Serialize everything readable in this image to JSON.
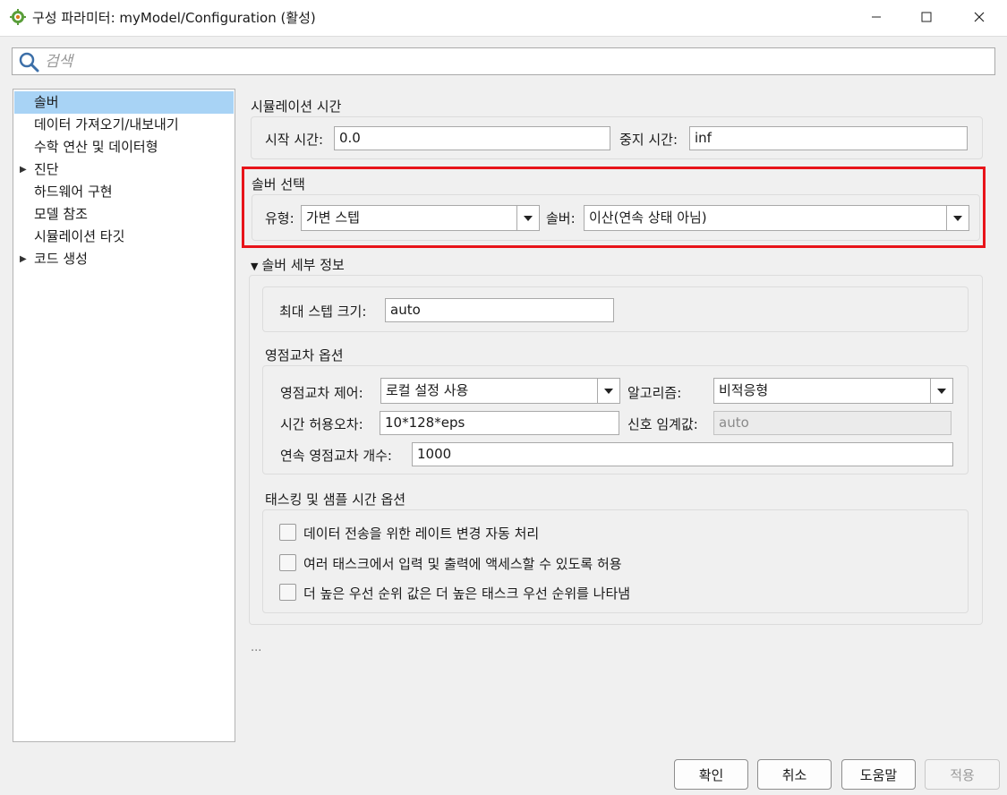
{
  "window": {
    "title": "구성 파라미터: myModel/Configuration (활성)",
    "icons": {
      "app": "simulink-gear-icon",
      "minimize": "minimize-icon",
      "maximize": "maximize-icon",
      "close": "close-icon"
    }
  },
  "search": {
    "placeholder": "검색",
    "value": ""
  },
  "tree": {
    "items": [
      {
        "label": "솔버",
        "selected": true,
        "expandable": false
      },
      {
        "label": "데이터 가져오기/내보내기",
        "selected": false,
        "expandable": false
      },
      {
        "label": "수학 연산 및 데이터형",
        "selected": false,
        "expandable": false
      },
      {
        "label": "진단",
        "selected": false,
        "expandable": true
      },
      {
        "label": "하드웨어 구현",
        "selected": false,
        "expandable": false
      },
      {
        "label": "모델 참조",
        "selected": false,
        "expandable": false
      },
      {
        "label": "시뮬레이션 타깃",
        "selected": false,
        "expandable": false
      },
      {
        "label": "코드 생성",
        "selected": false,
        "expandable": true
      }
    ]
  },
  "sim_time": {
    "title": "시뮬레이션 시간",
    "start_label": "시작 시간:",
    "start_value": "0.0",
    "stop_label": "중지 시간:",
    "stop_value": "inf"
  },
  "solver_select": {
    "title": "솔버 선택",
    "type_label": "유형:",
    "type_value": "가변 스텝",
    "solver_label": "솔버:",
    "solver_value": "이산(연속 상태 아님)"
  },
  "solver_details": {
    "title": "솔버 세부 정보",
    "max_step_label": "최대 스텝 크기:",
    "max_step_value": "auto"
  },
  "zero_crossing": {
    "title": "영점교차 옵션",
    "control_label": "영점교차 제어:",
    "control_value": "로컬 설정 사용",
    "algorithm_label": "알고리즘:",
    "algorithm_value": "비적응형",
    "tolerance_label": "시간 허용오차:",
    "tolerance_value": "10*128*eps",
    "threshold_label": "신호 임계값:",
    "threshold_value": "auto",
    "count_label": "연속 영점교차 개수:",
    "count_value": "1000"
  },
  "tasking": {
    "title": "태스킹 및 샘플 시간 옵션",
    "options": [
      {
        "label": "데이터 전송을 위한 레이트 변경 자동 처리",
        "checked": false
      },
      {
        "label": "여러 태스크에서 입력 및 출력에 액세스할 수 있도록 허용",
        "checked": false
      },
      {
        "label": "더 높은 우선 순위 값은 더 높은 태스크 우선 순위를 나타냄",
        "checked": false
      }
    ]
  },
  "more": {
    "ellipsis": "..."
  },
  "buttons": {
    "ok": "확인",
    "cancel": "취소",
    "help": "도움말",
    "apply": "적용"
  },
  "colors": {
    "highlight": "#e8141a",
    "selection": "#a8d3f5"
  }
}
